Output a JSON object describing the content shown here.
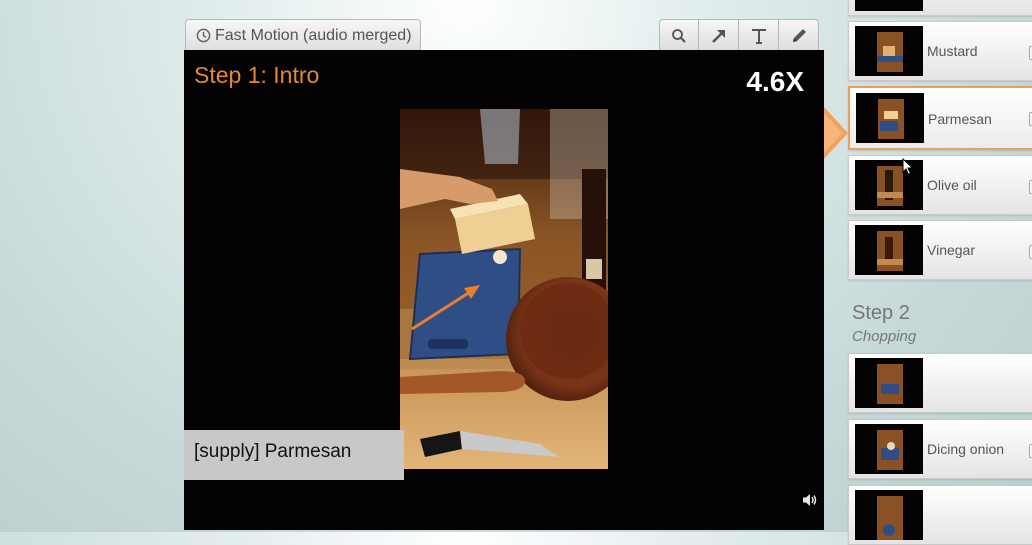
{
  "mode_tab": {
    "label": "Fast Motion (audio merged)",
    "icon": "clock-icon"
  },
  "toolbar": {
    "tools": [
      "search-icon",
      "arrow-icon",
      "text-icon",
      "pencil-icon"
    ]
  },
  "player": {
    "step_title": "Step 1: Intro",
    "speed": "4.6X",
    "caption": "[supply] Parmesan",
    "accent_color": "#e08a35"
  },
  "sidebar": {
    "step1_items": [
      {
        "label": ""
      },
      {
        "label": "Mustard"
      },
      {
        "label": "Parmesan",
        "selected": true
      },
      {
        "label": "Olive oil"
      },
      {
        "label": "Vinegar"
      }
    ],
    "step2": {
      "title": "Step 2",
      "subtitle": "Chopping",
      "items": [
        {
          "label": ""
        },
        {
          "label": "Dicing onion"
        },
        {
          "label": ""
        }
      ]
    }
  }
}
